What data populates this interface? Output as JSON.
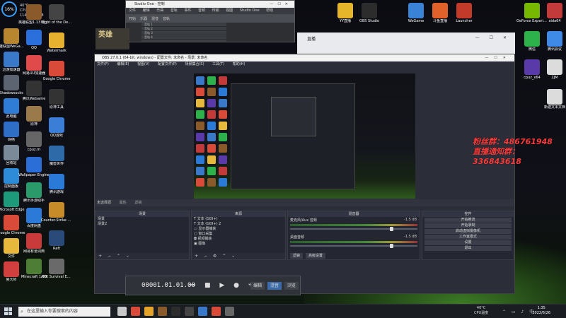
{
  "perf": {
    "cpu_pct": "16%",
    "temp": "40°C",
    "cpu_label": "CPU温度",
    "net": "1145/141978"
  },
  "desktop_left": [
    {
      "label": "英雄联盟WeGame版",
      "color": "#b8862f"
    },
    {
      "label": "迅游加速器",
      "color": "#3a78c9"
    },
    {
      "label": "Shadowsocks",
      "color": "#5b6470"
    },
    {
      "label": "此电脑",
      "color": "#2e7cd6"
    },
    {
      "label": "网络",
      "color": "#2e6ec6"
    },
    {
      "label": "回收站",
      "color": "#7a8a99"
    },
    {
      "label": "控制面板",
      "color": "#2d8bd8"
    },
    {
      "label": "Microsoft Edge",
      "color": "#1c9a7a"
    },
    {
      "label": "Google Chrome",
      "color": "#d94a38"
    },
    {
      "label": "文件",
      "color": "#e6b93c"
    },
    {
      "label": "鲁大师",
      "color": "#d13f3f"
    }
  ],
  "desktop_col2": [
    {
      "label": "英雄联盟1.13 无删减版",
      "color": "#8a5a2a"
    },
    {
      "label": "QQ",
      "color": "#2a6fdc"
    },
    {
      "label": "网易UU加速器",
      "color": "#e04a4a"
    },
    {
      "label": "腾讯WeGame",
      "color": "#333"
    },
    {
      "label": "原神",
      "color": "#9a7a4a"
    },
    {
      "label": "cpuz.rn",
      "color": "#666"
    },
    {
      "label": "Wallpaper Engine",
      "color": "#2b6ed8"
    },
    {
      "label": "腾讯手游助手",
      "color": "#2a9a6a"
    },
    {
      "label": "百度网盘",
      "color": "#2b7ad8"
    },
    {
      "label": "网易有道词典",
      "color": "#c93a3a"
    },
    {
      "label": "Minecraft 1.13",
      "color": "#4e7d36"
    }
  ],
  "desktop_col3": [
    {
      "label": "Night of the Dead",
      "color": "#444"
    },
    {
      "label": "Watermark",
      "color": "#e5b12e"
    },
    {
      "label": "Google Chrome",
      "color": "#d94a38"
    },
    {
      "label": "原神工具",
      "color": "#333"
    },
    {
      "label": "QQ游戏",
      "color": "#3a7ed8"
    },
    {
      "label": "魔兽世界",
      "color": "#2e6aa8"
    },
    {
      "label": "腾讯游戏",
      "color": "#2a7ad8"
    },
    {
      "label": "Counter-Strike Global Off.",
      "color": "#c78b2a"
    },
    {
      "label": "Raft",
      "color": "#2a4a7a"
    },
    {
      "label": "ARK Survival Evolved",
      "color": "#6a6a6a"
    }
  ],
  "desktop_right": [
    {
      "label": "GeForce Experience",
      "color": "#76b900"
    },
    {
      "label": "aida64",
      "color": "#c23a3a"
    },
    {
      "label": "微信",
      "color": "#2db14a"
    },
    {
      "label": "腾讯会议",
      "color": "#3f8ae6"
    },
    {
      "label": "cpuz_x64",
      "color": "#5a3aa8"
    },
    {
      "label": "新建文本文档",
      "color": "#dcdcdc"
    },
    {
      "label": "ZJM",
      "color": "#dcdcdc"
    }
  ],
  "top_icons": [
    {
      "label": "WeGame",
      "color": "#3a82d6"
    },
    {
      "label": "斗鱼直播",
      "color": "#e0612a"
    },
    {
      "label": "Launcher",
      "color": "#c23a2a"
    },
    {
      "label": "OBS Studio",
      "color": "#2c2c2c"
    },
    {
      "label": "YY直播",
      "color": "#e6b52a"
    }
  ],
  "studio": {
    "title": "Studio One - 控制",
    "menu": [
      "文件",
      "编辑",
      "乐曲",
      "音轨",
      "事件",
      "音频",
      "传输",
      "视图",
      "Studio One",
      "帮助"
    ],
    "tools": [
      "开始",
      "乐器",
      "混音",
      "音轨"
    ],
    "tracks": [
      "音轨 1",
      "音轨 2",
      "音轨 3",
      "音轨 4"
    ]
  },
  "game_banner": "英雄",
  "browser": {
    "title": "直播",
    "controls": "— ☐ ✕"
  },
  "obs": {
    "title": "OBS 27.0.1 (64-bit, windows) - 配置文件: 未命名 - 场景: 未命名",
    "menu": [
      "文件(F)",
      "编辑(E)",
      "视图(V)",
      "配置文件(P)",
      "场景集合(S)",
      "工具(T)",
      "帮助(H)"
    ],
    "status": "未选择源",
    "status_props": "属性",
    "status_filters": "滤镜",
    "scenes": {
      "header": "场景",
      "items": [
        "场景",
        "场景2"
      ]
    },
    "sources": {
      "header": "来源",
      "items": [
        "文本 (GDI+)",
        "文本 (GDI+) 2",
        "显示器捕获",
        "窗口采集",
        "视频捕获",
        "图像"
      ]
    },
    "mixer": {
      "header": "混音器",
      "channels": [
        {
          "name": "麦克风/Aux 音频",
          "db": "-1.5 dB"
        },
        {
          "name": "桌面音频",
          "db": "-1.5 dB"
        }
      ],
      "tabs": [
        "滤镜",
        "高级设置"
      ]
    },
    "transitions": {
      "header": "转场"
    },
    "controls": {
      "header": "控件",
      "buttons": [
        "开始推流",
        "开始录制",
        "启动虚拟摄像机",
        "工作室模式",
        "设置",
        "退出"
      ]
    }
  },
  "transport": {
    "time": "00001.01.01.00",
    "buttons": "⏮ ■ ▶ ● ⟲",
    "tabs": [
      "编辑",
      "混音",
      "浏览"
    ]
  },
  "watermark": {
    "line1": "粉丝群：486761948",
    "line2": "直播通知群：336843618"
  },
  "taskbar": {
    "search_placeholder": "在这里输入你要搜索的内容",
    "tray_temp": "40°C",
    "tray_label": "CPU温度",
    "clock_time": "1:35",
    "clock_date": "2022/6/26",
    "apps": [
      "#c9c9c9",
      "#d94a38",
      "#e6a32a",
      "#8a5a2a",
      "#2c2c2c",
      "#444",
      "#3a78c9",
      "#d94a38",
      "#666"
    ]
  }
}
